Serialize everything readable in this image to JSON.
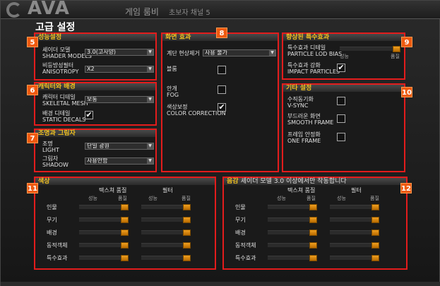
{
  "window": {
    "logo_text": "AVA",
    "game_label": "게임 룸비",
    "channel": "초보자 채널 5",
    "title": "고급 설정"
  },
  "panels": {
    "p5": {
      "badge": "5",
      "title": "성능설정"
    },
    "p6": {
      "badge": "6",
      "title": "캐릭터와 배경"
    },
    "p7": {
      "badge": "7",
      "title": "조명과 그림자"
    },
    "p8": {
      "badge": "8",
      "title": "화면 효과"
    },
    "p9": {
      "badge": "9",
      "title": "향상된 특수효과"
    },
    "p10": {
      "badge": "10",
      "title": "기타 설정"
    },
    "p11": {
      "badge": "11",
      "title": "색상"
    },
    "p12": {
      "badge": "12",
      "title": "음감",
      "note": "셰이더 모델 3.0 이상에서만 작동합니다"
    }
  },
  "settings": {
    "shader": {
      "label_ko": "셰이더 모델",
      "label_en": "SHADER MODELS",
      "value": "3.0(고사양)"
    },
    "aniso": {
      "label_ko": "비등방성필터",
      "label_en": "ANISOTROPY",
      "value": "X2"
    },
    "skeletal": {
      "label_ko": "캐릭터 디테일",
      "label_en": "SKELETAL MESH",
      "value": "보통"
    },
    "static": {
      "label_ko": "배경 디테일",
      "label_en": "STATIC DECALS",
      "checked": true
    },
    "light": {
      "label_ko": "조명",
      "label_en": "LIGHT",
      "value": "단일 광원"
    },
    "shadow": {
      "label_ko": "그림자",
      "label_en": "SHADOW",
      "value": "사용안함"
    },
    "aa": {
      "label_ko": "계단 현상제거",
      "value": "사용 불가"
    },
    "bloom": {
      "label_ko": "블룸",
      "checked": false
    },
    "fog": {
      "label_ko": "안개",
      "label_en": "FOG",
      "checked": false
    },
    "color": {
      "label_ko": "색상보정",
      "label_en": "COLOR CORRECTION",
      "checked": true
    },
    "particle": {
      "label_ko": "특수효과 디테일",
      "label_en": "PARTICLE LOD BIAS",
      "low": "성능",
      "high": "품질",
      "level": 1.0
    },
    "impact": {
      "label_ko": "특수효과 강화",
      "label_en": "IMPACT PARTICLES",
      "checked": true
    },
    "vsync": {
      "label_ko": "수직동기화",
      "label_en": "V-SYNC",
      "checked": false
    },
    "smooth": {
      "label_ko": "부드러운 화면",
      "label_en": "SMOOTH FRAME",
      "checked": false
    },
    "oneframe": {
      "label_ko": "프레임 안정화",
      "label_en": "ONE FRAME",
      "checked": false
    }
  },
  "quality_grid": {
    "col_texture": "텍스쳐 품질",
    "col_filter": "필터",
    "low": "성능",
    "high": "품질",
    "rows": [
      "인물",
      "무기",
      "배경",
      "동적객체",
      "특수효과"
    ]
  }
}
